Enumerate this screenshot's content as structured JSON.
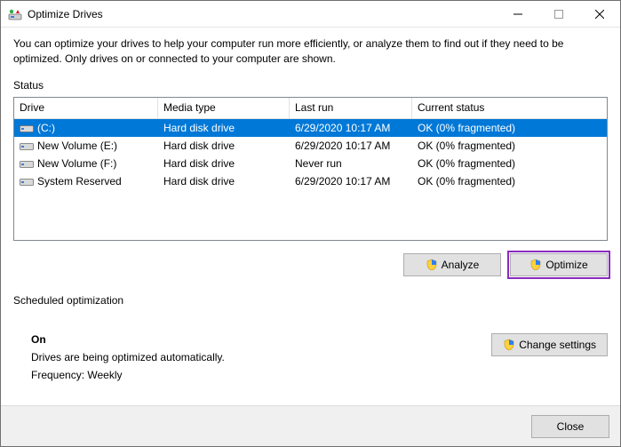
{
  "window": {
    "title": "Optimize Drives",
    "description": "You can optimize your drives to help your computer run more efficiently, or analyze them to find out if they need to be optimized. Only drives on or connected to your computer are shown."
  },
  "status_label": "Status",
  "columns": {
    "drive": "Drive",
    "media": "Media type",
    "last": "Last run",
    "status": "Current status"
  },
  "drives": [
    {
      "name": "(C:)",
      "media": "Hard disk drive",
      "last": "6/29/2020 10:17 AM",
      "status": "OK (0% fragmented)",
      "selected": true
    },
    {
      "name": "New Volume (E:)",
      "media": "Hard disk drive",
      "last": "6/29/2020 10:17 AM",
      "status": "OK (0% fragmented)",
      "selected": false
    },
    {
      "name": "New Volume (F:)",
      "media": "Hard disk drive",
      "last": "Never run",
      "status": "OK (0% fragmented)",
      "selected": false
    },
    {
      "name": "System Reserved",
      "media": "Hard disk drive",
      "last": "6/29/2020 10:17 AM",
      "status": "OK (0% fragmented)",
      "selected": false
    }
  ],
  "buttons": {
    "analyze": "Analyze",
    "optimize": "Optimize",
    "change_settings": "Change settings",
    "close": "Close"
  },
  "sched": {
    "label": "Scheduled optimization",
    "on": "On",
    "desc": "Drives are being optimized automatically.",
    "freq": "Frequency: Weekly"
  }
}
